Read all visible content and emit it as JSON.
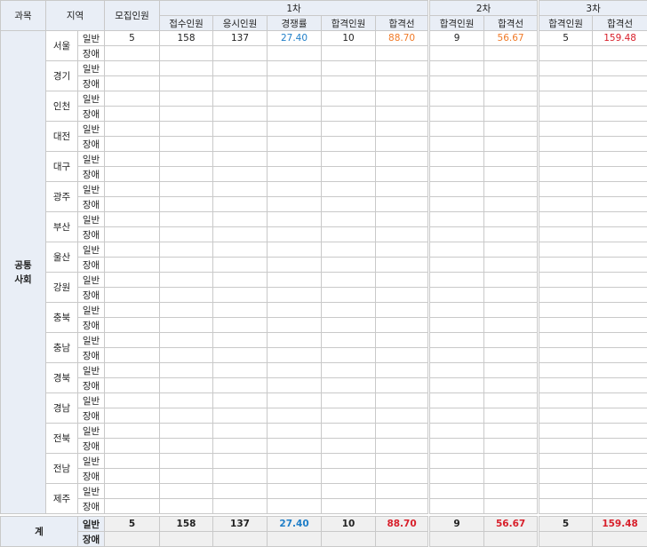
{
  "headers": {
    "subject": "과목",
    "region": "지역",
    "recruit": "모집인원",
    "stage1": "1차",
    "stage2": "2차",
    "stage3": "3차",
    "applicants": "접수인원",
    "takers": "응시인원",
    "competition": "경쟁률",
    "passers": "합격인원",
    "cutoff": "합격선"
  },
  "subject_name": "공통\n사회",
  "types": {
    "general": "일반",
    "disabled": "장애"
  },
  "regions": [
    "서울",
    "경기",
    "인천",
    "대전",
    "대구",
    "광주",
    "부산",
    "울산",
    "강원",
    "충북",
    "충남",
    "경북",
    "경남",
    "전북",
    "전남",
    "제주"
  ],
  "seoul_general": {
    "recruit": "5",
    "applicants": "158",
    "takers": "137",
    "competition": "27.40",
    "passers1": "10",
    "cutoff1": "88.70",
    "passers2": "9",
    "cutoff2": "56.67",
    "passers3": "5",
    "cutoff3": "159.48"
  },
  "total": {
    "label": "계",
    "recruit": "5",
    "applicants": "158",
    "takers": "137",
    "competition": "27.40",
    "passers1": "10",
    "cutoff1": "88.70",
    "passers2": "9",
    "cutoff2": "56.67",
    "passers3": "5",
    "cutoff3": "159.48"
  },
  "colors": {
    "header_bg": "#e9eef6",
    "competition": "#1f7ec8",
    "cutoff_mid": "#f07a28",
    "cutoff_final": "#d8202b"
  }
}
